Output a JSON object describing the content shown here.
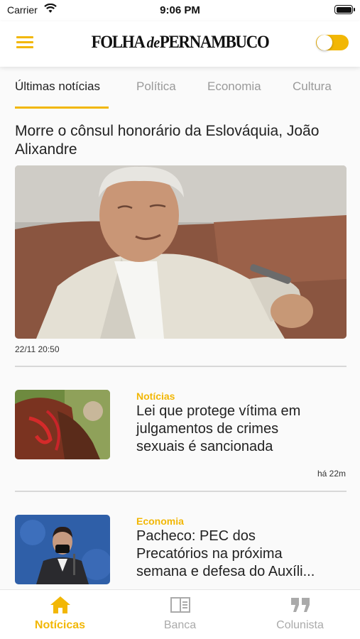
{
  "status_bar": {
    "carrier": "Carrier",
    "time": "9:06 PM"
  },
  "header": {
    "logo_part1": "FOLHA ",
    "logo_part2": "de",
    "logo_part3": "PERNAMBUCO",
    "toggle_on": true
  },
  "tabs": [
    {
      "label": "Últimas notícias",
      "active": true
    },
    {
      "label": "Política",
      "active": false
    },
    {
      "label": "Economia",
      "active": false
    },
    {
      "label": "Cultura",
      "active": false
    }
  ],
  "featured": {
    "title": "Morre o cônsul honorário da Eslováquia, João Alixandre",
    "time": "22/11 20:50"
  },
  "news": [
    {
      "category": "Notícias",
      "title": "Lei que protege vítima em\njulgamentos de crimes\nsexuais é sancionada",
      "time": "há 22m"
    },
    {
      "category": "Economia",
      "title": "Pacheco: PEC dos\nPrecatórios na próxima\nsemana e defesa do Auxíli..."
    }
  ],
  "bottom_nav": [
    {
      "label": "Notícicas",
      "icon": "home-icon",
      "active": true
    },
    {
      "label": "Banca",
      "icon": "newspaper-icon",
      "active": false
    },
    {
      "label": "Colunista",
      "icon": "quote-icon",
      "active": false
    }
  ],
  "colors": {
    "accent": "#f2b705",
    "inactive": "#aaaaaa"
  }
}
